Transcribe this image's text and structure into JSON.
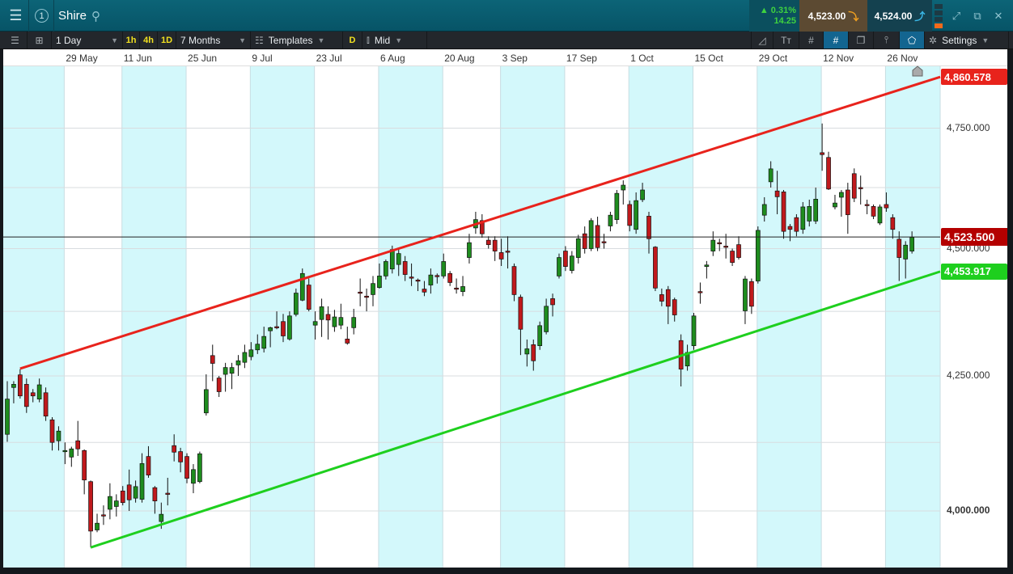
{
  "header": {
    "instrument": "Shire",
    "change_pct": "▲ 0.31%",
    "change_abs": "14.25",
    "sell_price": "4,523.00",
    "buy_price": "4,524.00",
    "panel_number": "1"
  },
  "toolbar": {
    "interval": "1 Day",
    "quick": [
      "1h",
      "4h",
      "1D"
    ],
    "range": "7 Months",
    "templates": "Templates",
    "d_label": "D",
    "price_type": "Mid",
    "settings": "Settings"
  },
  "colors": {
    "up": "#1e8c1e",
    "down": "#c0191c",
    "upper_line": "#e8231c",
    "lower_line": "#1ecf1e",
    "band": "#d3f8fb",
    "price_tag": "#b40000"
  },
  "chart_data": {
    "type": "candlestick",
    "scale": "log",
    "ylim": [
      3900,
      4930
    ],
    "y_ticks": [
      {
        "v": 4000,
        "label": "4,000.000"
      },
      {
        "v": 4250,
        "label": "4,250.000"
      },
      {
        "v": 4500,
        "label": "4,500.000"
      },
      {
        "v": 4750,
        "label": "4,750.000"
      }
    ],
    "x_labels": [
      {
        "i": 9,
        "label": "29 May"
      },
      {
        "i": 18,
        "label": "11 Jun"
      },
      {
        "i": 28,
        "label": "25 Jun"
      },
      {
        "i": 38,
        "label": "9 Jul"
      },
      {
        "i": 48,
        "label": "23 Jul"
      },
      {
        "i": 58,
        "label": "6 Aug"
      },
      {
        "i": 68,
        "label": "20 Aug"
      },
      {
        "i": 77,
        "label": "3 Sep"
      },
      {
        "i": 87,
        "label": "17 Sep"
      },
      {
        "i": 97,
        "label": "1 Oct"
      },
      {
        "i": 107,
        "label": "15 Oct"
      },
      {
        "i": 117,
        "label": "29 Oct"
      },
      {
        "i": 127,
        "label": "12 Nov"
      },
      {
        "i": 137,
        "label": "26 Nov"
      }
    ],
    "current_price": {
      "value": 4523.5,
      "label": "4,523.500"
    },
    "upper_trendline": {
      "start_index": 2,
      "start_value": 4264,
      "end_value": 4860.578,
      "label": "4,860.578"
    },
    "lower_trendline": {
      "start_index": 13,
      "start_value": 3935,
      "end_value": 4453.917,
      "label": "4,453.917"
    },
    "ohlc": [
      [
        4140,
        4240,
        4126,
        4206
      ],
      [
        4228,
        4240,
        4198,
        4234
      ],
      [
        4252,
        4263,
        4207,
        4212
      ],
      [
        4234,
        4245,
        4180,
        4192
      ],
      [
        4218,
        4225,
        4200,
        4212
      ],
      [
        4206,
        4245,
        4200,
        4233
      ],
      [
        4218,
        4228,
        4165,
        4174
      ],
      [
        4167,
        4172,
        4110,
        4125
      ],
      [
        4128,
        4155,
        4110,
        4146
      ],
      [
        4110,
        4125,
        4085,
        4110
      ],
      [
        4098,
        4117,
        4080,
        4113
      ],
      [
        4128,
        4165,
        4100,
        4113
      ],
      [
        4110,
        4112,
        4030,
        4056
      ],
      [
        4053,
        4055,
        3935,
        3964
      ],
      [
        3966,
        3995,
        3962,
        3978
      ],
      [
        3993,
        4010,
        3975,
        3992
      ],
      [
        4003,
        4050,
        3985,
        4026
      ],
      [
        4008,
        4030,
        3990,
        4018
      ],
      [
        4036,
        4045,
        4010,
        4015
      ],
      [
        4047,
        4075,
        4000,
        4020
      ],
      [
        4023,
        4055,
        4015,
        4044
      ],
      [
        4021,
        4105,
        4015,
        4086
      ],
      [
        4099,
        4118,
        4060,
        4065
      ],
      [
        4042,
        4045,
        3995,
        4018
      ],
      [
        3981,
        4015,
        3968,
        3994
      ],
      [
        4032,
        4060,
        4010,
        4031
      ],
      [
        4119,
        4140,
        4090,
        4107
      ],
      [
        4108,
        4115,
        4070,
        4089
      ],
      [
        4099,
        4105,
        4050,
        4059
      ],
      [
        4050,
        4085,
        4032,
        4075
      ],
      [
        4053,
        4108,
        4050,
        4104
      ],
      [
        4180,
        4253,
        4175,
        4224
      ],
      [
        4289,
        4310,
        4240,
        4274
      ],
      [
        4246,
        4250,
        4210,
        4220
      ],
      [
        4253,
        4275,
        4220,
        4266
      ],
      [
        4255,
        4275,
        4225,
        4266
      ],
      [
        4271,
        4290,
        4250,
        4279
      ],
      [
        4276,
        4310,
        4265,
        4295
      ],
      [
        4287,
        4315,
        4280,
        4300
      ],
      [
        4300,
        4330,
        4292,
        4311
      ],
      [
        4303,
        4345,
        4295,
        4326
      ],
      [
        4337,
        4345,
        4305,
        4343
      ],
      [
        4345,
        4375,
        4340,
        4344
      ],
      [
        4355,
        4370,
        4315,
        4327
      ],
      [
        4321,
        4375,
        4318,
        4366
      ],
      [
        4369,
        4420,
        4365,
        4411
      ],
      [
        4397,
        4460,
        4395,
        4450
      ],
      [
        4427,
        4440,
        4375,
        4379
      ],
      [
        4348,
        4375,
        4320,
        4355
      ],
      [
        4359,
        4400,
        4325,
        4384
      ],
      [
        4369,
        4385,
        4320,
        4358
      ],
      [
        4345,
        4378,
        4335,
        4364
      ],
      [
        4348,
        4390,
        4340,
        4363
      ],
      [
        4321,
        4345,
        4310,
        4313
      ],
      [
        4343,
        4380,
        4330,
        4363
      ],
      [
        4413,
        4440,
        4385,
        4412
      ],
      [
        4405,
        4420,
        4375,
        4404
      ],
      [
        4408,
        4445,
        4385,
        4430
      ],
      [
        4422,
        4470,
        4420,
        4445
      ],
      [
        4445,
        4478,
        4438,
        4474
      ],
      [
        4459,
        4506,
        4450,
        4498
      ],
      [
        4468,
        4502,
        4445,
        4490
      ],
      [
        4474,
        4485,
        4435,
        4448
      ],
      [
        4443,
        4470,
        4425,
        4442
      ],
      [
        4437,
        4440,
        4415,
        4436
      ],
      [
        4419,
        4435,
        4405,
        4413
      ],
      [
        4427,
        4460,
        4410,
        4447
      ],
      [
        4446,
        4450,
        4430,
        4445
      ],
      [
        4445,
        4490,
        4440,
        4474
      ],
      [
        4450,
        4455,
        4425,
        4432
      ],
      [
        4421,
        4440,
        4410,
        4420
      ],
      [
        4414,
        4445,
        4405,
        4424
      ],
      [
        4482,
        4530,
        4470,
        4512
      ],
      [
        4542,
        4575,
        4530,
        4559
      ],
      [
        4557,
        4570,
        4522,
        4530
      ],
      [
        4517,
        4525,
        4500,
        4508
      ],
      [
        4517,
        4525,
        4475,
        4495
      ],
      [
        4492,
        4520,
        4465,
        4479
      ],
      [
        4495,
        4525,
        4460,
        4494
      ],
      [
        4464,
        4470,
        4395,
        4408
      ],
      [
        4403,
        4408,
        4290,
        4340
      ],
      [
        4292,
        4320,
        4268,
        4302
      ],
      [
        4310,
        4320,
        4260,
        4279
      ],
      [
        4308,
        4355,
        4300,
        4347
      ],
      [
        4335,
        4400,
        4330,
        4385
      ],
      [
        4400,
        4410,
        4365,
        4388
      ],
      [
        4445,
        4490,
        4440,
        4482
      ],
      [
        4495,
        4505,
        4455,
        4464
      ],
      [
        4456,
        4495,
        4450,
        4485
      ],
      [
        4482,
        4528,
        4470,
        4520
      ],
      [
        4530,
        4545,
        4490,
        4500
      ],
      [
        4500,
        4562,
        4495,
        4557
      ],
      [
        4547,
        4565,
        4495,
        4502
      ],
      [
        4514,
        4530,
        4500,
        4513
      ],
      [
        4546,
        4575,
        4535,
        4568
      ],
      [
        4559,
        4620,
        4550,
        4613
      ],
      [
        4620,
        4640,
        4590,
        4630
      ],
      [
        4590,
        4598,
        4535,
        4547
      ],
      [
        4539,
        4615,
        4530,
        4598
      ],
      [
        4600,
        4635,
        4595,
        4620
      ],
      [
        4566,
        4575,
        4490,
        4520
      ],
      [
        4503,
        4505,
        4415,
        4421
      ],
      [
        4408,
        4420,
        4385,
        4395
      ],
      [
        4418,
        4425,
        4350,
        4385
      ],
      [
        4398,
        4402,
        4355,
        4368
      ],
      [
        4318,
        4330,
        4230,
        4263
      ],
      [
        4269,
        4310,
        4260,
        4295
      ],
      [
        4308,
        4372,
        4300,
        4366
      ],
      [
        4414,
        4432,
        4390,
        4413
      ],
      [
        4464,
        4475,
        4440,
        4467
      ],
      [
        4495,
        4535,
        4485,
        4517
      ],
      [
        4512,
        4520,
        4495,
        4511
      ],
      [
        4505,
        4530,
        4480,
        4504
      ],
      [
        4495,
        4500,
        4465,
        4472
      ],
      [
        4508,
        4525,
        4478,
        4482
      ],
      [
        4376,
        4445,
        4350,
        4439
      ],
      [
        4434,
        4440,
        4370,
        4385
      ],
      [
        4435,
        4545,
        4430,
        4537
      ],
      [
        4568,
        4605,
        4555,
        4590
      ],
      [
        4637,
        4680,
        4625,
        4664
      ],
      [
        4618,
        4660,
        4570,
        4606
      ],
      [
        4616,
        4620,
        4520,
        4535
      ],
      [
        4545,
        4550,
        4515,
        4539
      ],
      [
        4563,
        4570,
        4525,
        4535
      ],
      [
        4539,
        4595,
        4530,
        4585
      ],
      [
        4556,
        4600,
        4545,
        4586
      ],
      [
        4556,
        4625,
        4550,
        4601
      ],
      [
        4698,
        4760,
        4660,
        4694
      ],
      [
        4688,
        4700,
        4620,
        4622
      ],
      [
        4585,
        4610,
        4580,
        4593
      ],
      [
        4605,
        4620,
        4565,
        4615
      ],
      [
        4620,
        4635,
        4530,
        4569
      ],
      [
        4654,
        4665,
        4595,
        4603
      ],
      [
        4625,
        4650,
        4590,
        4624
      ],
      [
        4590,
        4600,
        4570,
        4589
      ],
      [
        4586,
        4590,
        4560,
        4566
      ],
      [
        4552,
        4590,
        4548,
        4585
      ],
      [
        4590,
        4615,
        4575,
        4583
      ],
      [
        4563,
        4570,
        4520,
        4539
      ],
      [
        4519,
        4535,
        4435,
        4482
      ],
      [
        4479,
        4515,
        4440,
        4507
      ],
      [
        4495,
        4535,
        4490,
        4523
      ]
    ]
  }
}
